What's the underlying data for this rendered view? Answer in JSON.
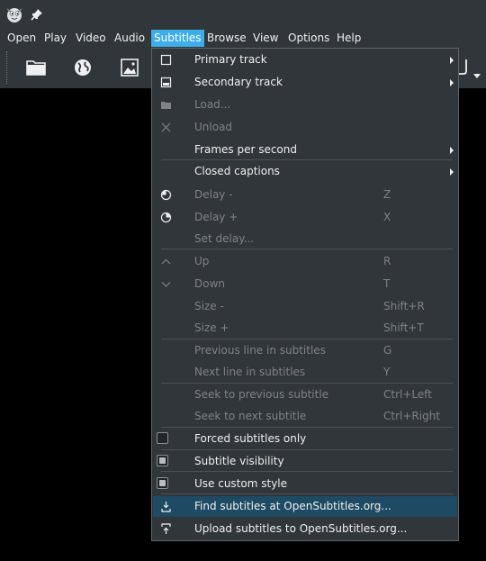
{
  "menubar": {
    "items": [
      "Open",
      "Play",
      "Video",
      "Audio",
      "Subtitles",
      "Browse",
      "View",
      "Options",
      "Help"
    ],
    "active": "Subtitles"
  },
  "menu": {
    "items": [
      {
        "label": "Primary track",
        "submenu": true,
        "icon": "checkbox-icon"
      },
      {
        "label": "Secondary track",
        "submenu": true,
        "icon": "secondary-track-icon"
      },
      {
        "label": "Load...",
        "disabled": true,
        "icon": "folder-icon"
      },
      {
        "label": "Unload",
        "disabled": true,
        "icon": "close-icon"
      },
      {
        "label": "Frames per second",
        "submenu": true
      },
      {
        "label": "Closed captions",
        "submenu": true
      },
      {
        "label": "Delay -",
        "shortcut": "Z",
        "disabled": true,
        "icon": "delay-minus-icon"
      },
      {
        "label": "Delay +",
        "shortcut": "X",
        "disabled": true,
        "icon": "delay-plus-icon"
      },
      {
        "label": "Set delay...",
        "disabled": true
      },
      {
        "label": "Up",
        "shortcut": "R",
        "disabled": true,
        "icon": "chevron-up-icon"
      },
      {
        "label": "Down",
        "shortcut": "T",
        "disabled": true,
        "icon": "chevron-down-icon"
      },
      {
        "label": "Size -",
        "shortcut": "Shift+R",
        "disabled": true
      },
      {
        "label": "Size +",
        "shortcut": "Shift+T",
        "disabled": true
      },
      {
        "label": "Previous line in subtitles",
        "shortcut": "G",
        "disabled": true
      },
      {
        "label": "Next line in subtitles",
        "shortcut": "Y",
        "disabled": true
      },
      {
        "label": "Seek to previous subtitle",
        "shortcut": "Ctrl+Left",
        "disabled": true
      },
      {
        "label": "Seek to next subtitle",
        "shortcut": "Ctrl+Right",
        "disabled": true
      },
      {
        "label": "Forced subtitles only",
        "checked": false
      },
      {
        "label": "Subtitle visibility",
        "checked": true
      },
      {
        "label": "Use custom style",
        "checked": true
      },
      {
        "label": "Find subtitles at OpenSubtitles.org...",
        "highlighted": true,
        "icon": "download-icon"
      },
      {
        "label": "Upload subtitles to OpenSubtitles.org...",
        "icon": "upload-icon"
      }
    ]
  }
}
